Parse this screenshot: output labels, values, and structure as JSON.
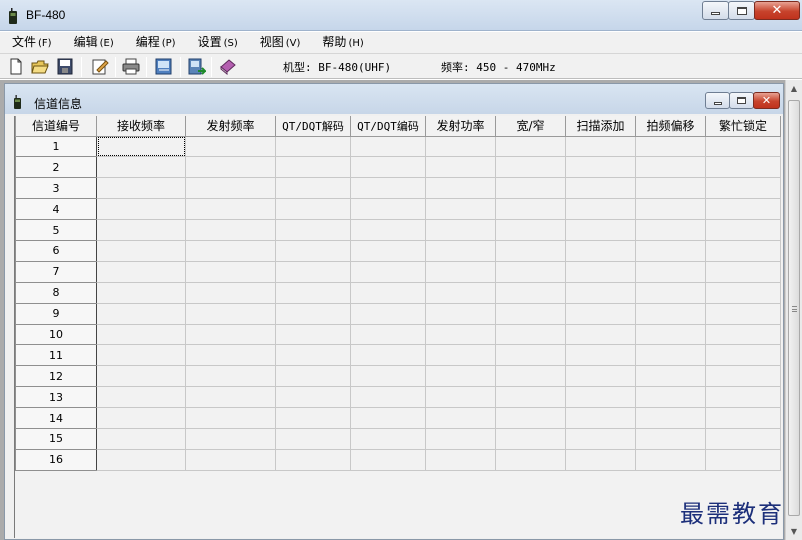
{
  "window": {
    "title": "BF-480"
  },
  "menu": [
    {
      "label": "文件",
      "key": "(F)"
    },
    {
      "label": "编辑",
      "key": "(E)"
    },
    {
      "label": "编程",
      "key": "(P)"
    },
    {
      "label": "设置",
      "key": "(S)"
    },
    {
      "label": "视图",
      "key": "(V)"
    },
    {
      "label": "帮助",
      "key": "(H)"
    }
  ],
  "toolbar": {
    "icons": [
      "new-file-icon",
      "open-folder-icon",
      "save-icon",
      "edit-icon",
      "print-icon",
      "read-radio-icon",
      "write-radio-icon",
      "book-icon"
    ],
    "model_label": "机型: BF-480(UHF)",
    "freq_label": "频率: 450 - 470MHz"
  },
  "child_window": {
    "title": "信道信息"
  },
  "table": {
    "columns": [
      "信道编号",
      "接收频率",
      "发射频率",
      "QT/DQT解码",
      "QT/DQT编码",
      "发射功率",
      "宽/窄",
      "扫描添加",
      "拍频偏移",
      "繁忙锁定"
    ],
    "rows": [
      "1",
      "2",
      "3",
      "4",
      "5",
      "6",
      "7",
      "8",
      "9",
      "10",
      "11",
      "12",
      "13",
      "14",
      "15",
      "16"
    ],
    "selected_row": 1,
    "selected_column": 2
  },
  "watermark": "最需教育",
  "colors": {
    "titlebar": "#c6d6ea",
    "close_button": "#c7432c",
    "watermark": "#1c2f7a"
  }
}
